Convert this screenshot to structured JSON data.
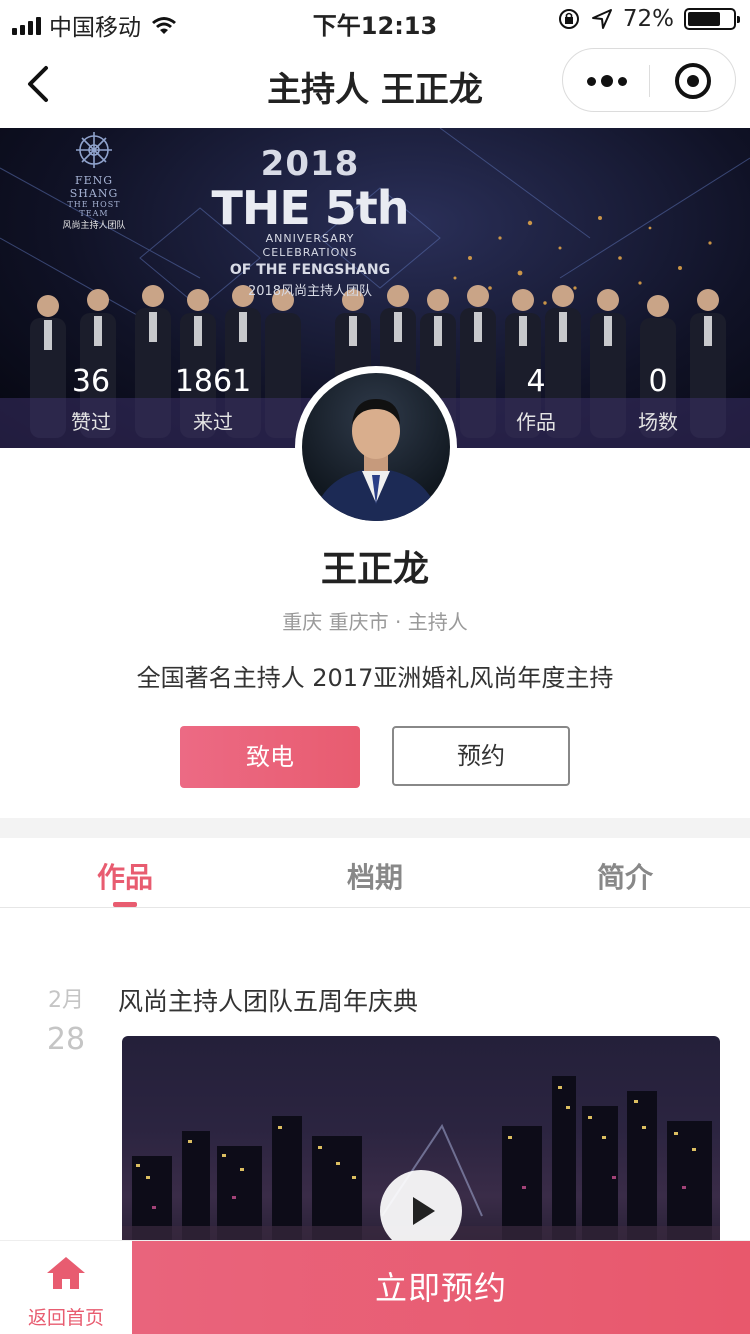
{
  "status_bar": {
    "carrier": "中国移动",
    "time": "下午12:13",
    "battery_text": "72%",
    "battery_level": 0.72
  },
  "nav": {
    "title": "主持人 王正龙"
  },
  "banner": {
    "brand_name": "FENG SHANG",
    "brand_team": "THE HOST TEAM",
    "brand_cn": "风尚主持人团队",
    "event_year": "2018",
    "event_the": "THE 5th",
    "event_anniversary": "ANNIVERSARY",
    "event_celebrations": "CELEBRATIONS",
    "event_of": "OF THE FENGSHANG",
    "event_cn": "2018风尚主持人团队",
    "stats": [
      {
        "value": "36",
        "label": "赞过"
      },
      {
        "value": "1861",
        "label": "来过"
      },
      {
        "value": "4",
        "label": "作品"
      },
      {
        "value": "0",
        "label": "场数"
      }
    ]
  },
  "profile": {
    "name": "王正龙",
    "meta": "重庆 重庆市 · 主持人",
    "bio": "全国著名主持人 2017亚洲婚礼风尚年度主持",
    "call_label": "致电",
    "book_label": "预约"
  },
  "tabs": [
    {
      "label": "作品",
      "active": true
    },
    {
      "label": "档期",
      "active": false
    },
    {
      "label": "简介",
      "active": false
    }
  ],
  "works": [
    {
      "month": "2月",
      "day": "28",
      "title": "风尚主持人团队五周年庆典"
    }
  ],
  "bottom": {
    "home_label": "返回首页",
    "book_now_label": "立即预约"
  },
  "colors": {
    "accent": "#e85c70",
    "tab_inactive": "#888888",
    "date_gray": "#c5c5c5"
  },
  "icons": [
    "back-arrow-icon",
    "more-dots-icon",
    "mini-program-close-icon",
    "play-icon",
    "home-icon",
    "wifi-icon",
    "location-arrow-icon",
    "rotation-lock-icon"
  ]
}
